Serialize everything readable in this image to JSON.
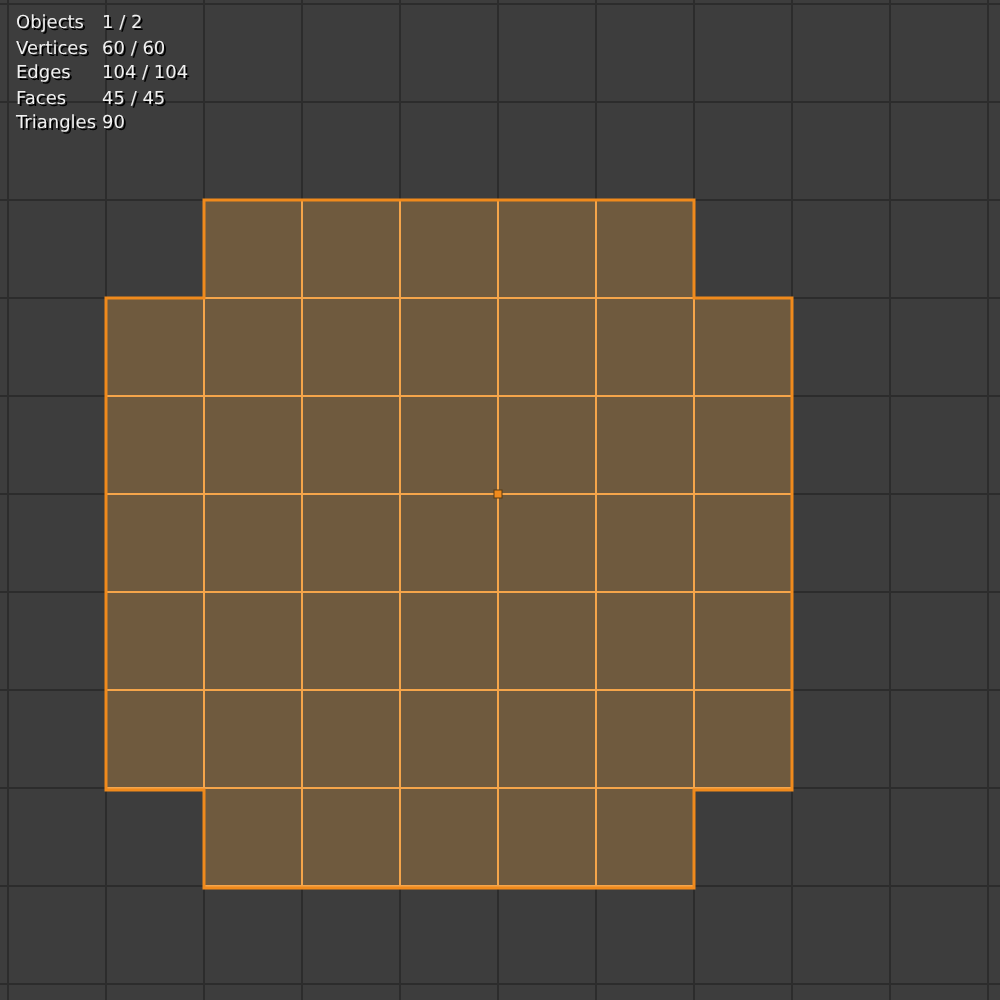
{
  "stats": [
    {
      "label": "Objects",
      "value": "1 / 2"
    },
    {
      "label": "Vertices",
      "value": "60 / 60"
    },
    {
      "label": "Edges",
      "value": "104 / 104"
    },
    {
      "label": "Faces",
      "value": "45 / 45"
    },
    {
      "label": "Triangles",
      "value": "90"
    }
  ]
}
